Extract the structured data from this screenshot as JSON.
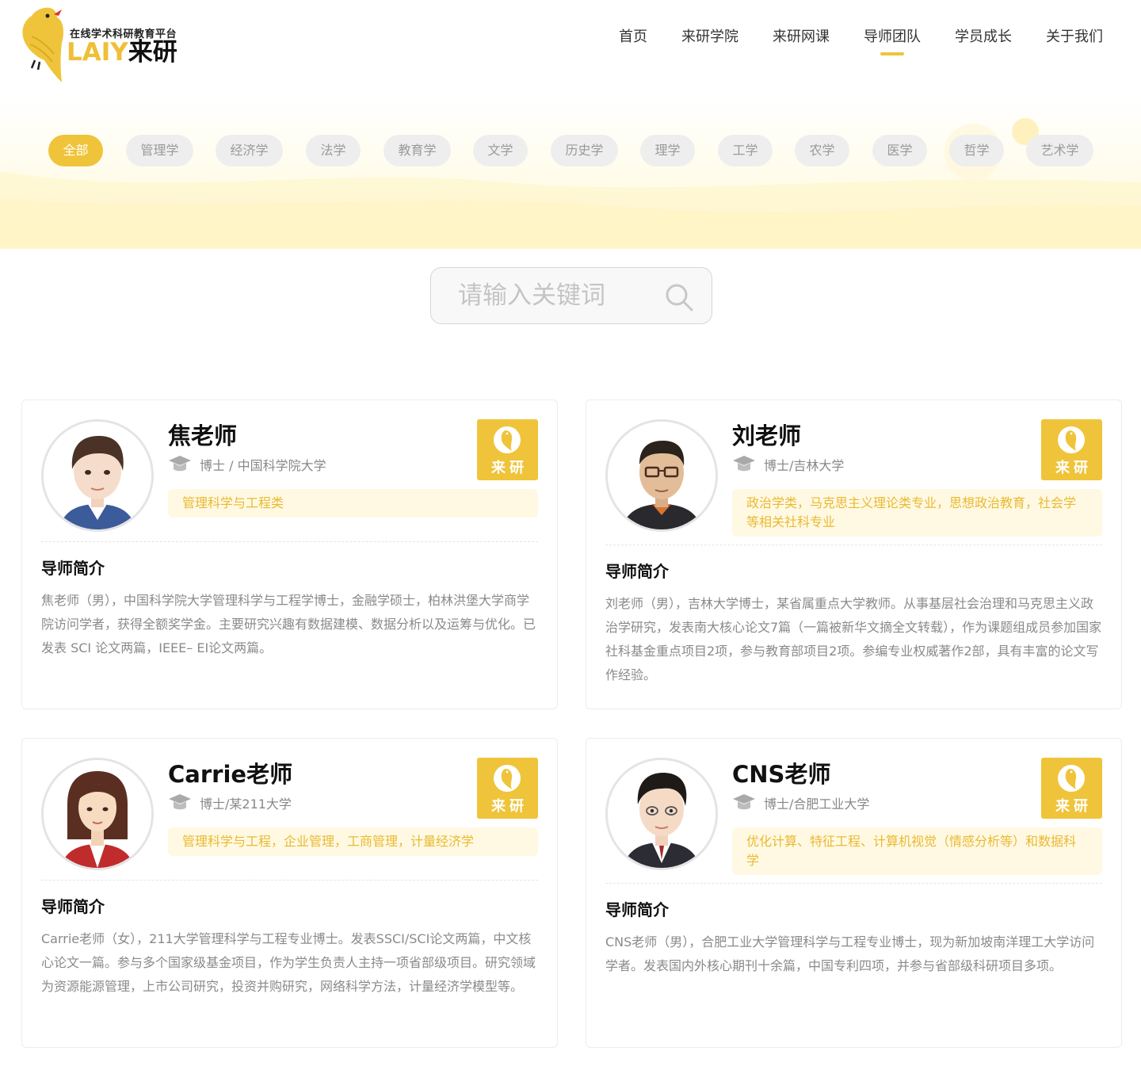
{
  "logo": {
    "slogan": "在线学术科研教育平台",
    "brand_latin": "LAIY",
    "brand_cn": "来研"
  },
  "nav": [
    {
      "label": "首页",
      "active": false
    },
    {
      "label": "来研学院",
      "active": false
    },
    {
      "label": "来研网课",
      "active": false
    },
    {
      "label": "导师团队",
      "active": true
    },
    {
      "label": "学员成长",
      "active": false
    },
    {
      "label": "关于我们",
      "active": false
    }
  ],
  "categories": [
    {
      "label": "全部",
      "active": true
    },
    {
      "label": "管理学",
      "active": false
    },
    {
      "label": "经济学",
      "active": false
    },
    {
      "label": "法学",
      "active": false
    },
    {
      "label": "教育学",
      "active": false
    },
    {
      "label": "文学",
      "active": false
    },
    {
      "label": "历史学",
      "active": false
    },
    {
      "label": "理学",
      "active": false
    },
    {
      "label": "工学",
      "active": false
    },
    {
      "label": "农学",
      "active": false
    },
    {
      "label": "医学",
      "active": false
    },
    {
      "label": "哲学",
      "active": false
    },
    {
      "label": "艺术学",
      "active": false
    }
  ],
  "search": {
    "placeholder": "请输入关键词",
    "value": ""
  },
  "badge_text": "来研",
  "section_title": "导师简介",
  "teachers": [
    {
      "name": "焦老师",
      "degree": "博士 / 中国科学院大学",
      "fields": "管理科学与工程类",
      "intro": "焦老师（男），中国科学院大学管理科学与工程学博士，金融学硕士，柏林洪堡大学商学院访问学者，获得全额奖学金。主要研究兴趣有数据建模、数据分析以及运筹与优化。已发表 SCI 论文两篇，IEEE– EI论文两篇。"
    },
    {
      "name": "刘老师",
      "degree": "博士/吉林大学",
      "fields": "政治学类，马克思主义理论类专业，思想政治教育，社会学等相关社科专业",
      "intro": "刘老师（男），吉林大学博士，某省属重点大学教师。从事基层社会治理和马克思主义政治学研究，发表南大核心论文7篇（一篇被新华文摘全文转载），作为课题组成员参加国家社科基金重点项目2项，参与教育部项目2项。参编专业权威著作2部，具有丰富的论文写作经验。"
    },
    {
      "name": "Carrie老师",
      "degree": "博士/某211大学",
      "fields": "管理科学与工程，企业管理，工商管理，计量经济学",
      "intro": "Carrie老师（女），211大学管理科学与工程专业博士。发表SSCI/SCI论文两篇，中文核心论文一篇。参与多个国家级基金项目，作为学生负责人主持一项省部级项目。研究领域为资源能源管理，上市公司研究，投资并购研究，网络科学方法，计量经济学模型等。"
    },
    {
      "name": "CNS老师",
      "degree": "博士/合肥工业大学",
      "fields": "优化计算、特征工程、计算机视觉（情感分析等）和数据科学",
      "intro": "CNS老师（男），合肥工业大学管理科学与工程专业博士，现为新加坡南洋理工大学访问学者。发表国内外核心期刊十余篇，中国专利四项，并参与省部级科研项目多项。"
    }
  ],
  "colors": {
    "accent": "#efc43a",
    "tag_bg": "#fff9e3",
    "tag_text": "#e9b930",
    "text_muted": "#8a8a8a"
  },
  "icons": {
    "search": "search-icon",
    "degree": "graduation-cap-icon",
    "badge": "bird-logo-icon"
  }
}
